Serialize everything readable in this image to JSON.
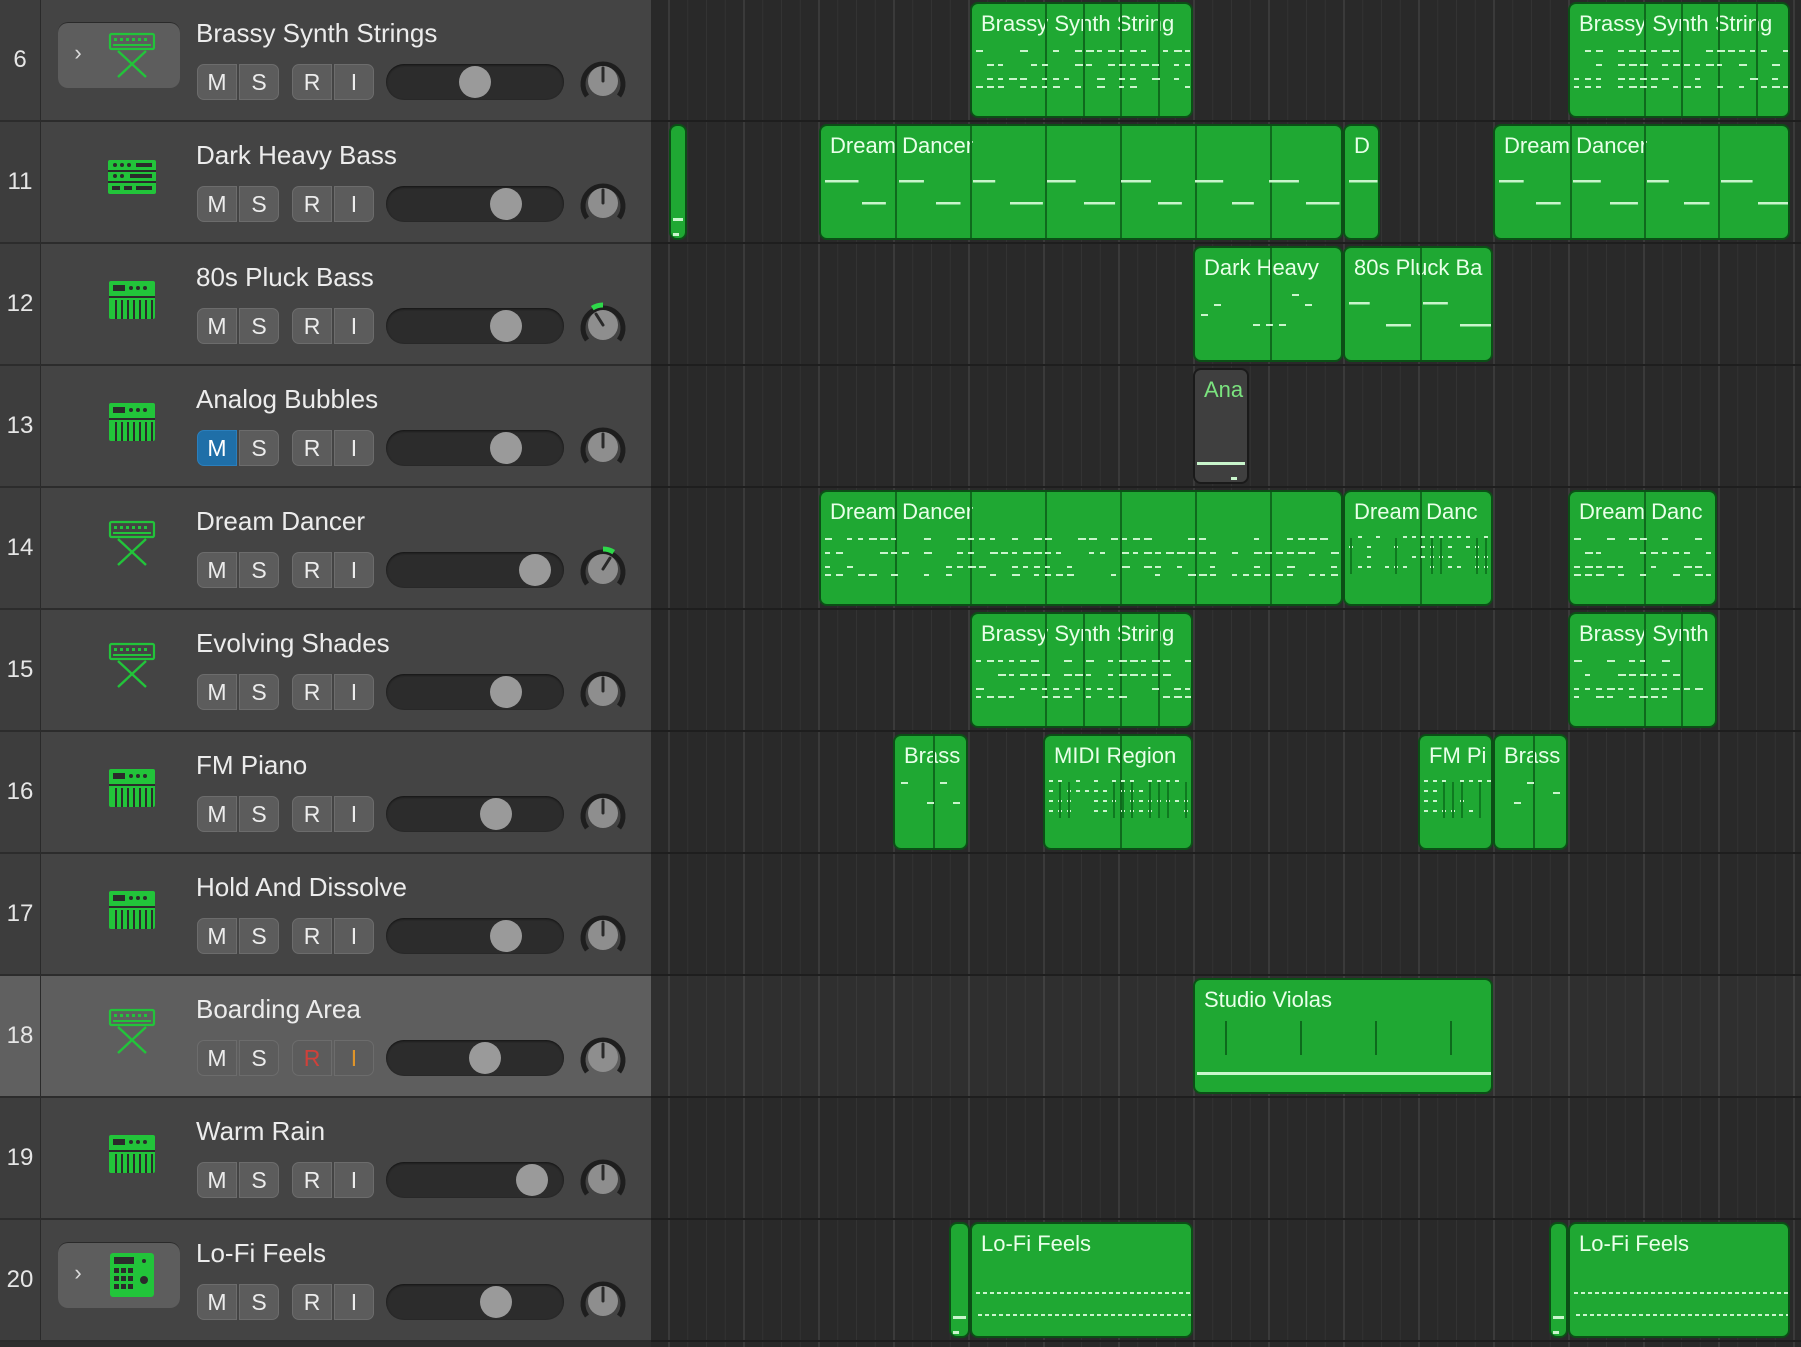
{
  "tracks": [
    {
      "number": "6",
      "name": "Brassy Synth Strings",
      "icon": "keyboard-stand-icon",
      "folder": true,
      "mute": false,
      "record": false,
      "input": false,
      "volume": 0.5,
      "pan": 0
    },
    {
      "number": "11",
      "name": "Dark Heavy Bass",
      "icon": "synth-rack-icon",
      "folder": false,
      "mute": false,
      "record": false,
      "input": false,
      "volume": 0.72,
      "pan": 0
    },
    {
      "number": "12",
      "name": "80s Pluck Bass",
      "icon": "synth-keyboard-icon",
      "folder": false,
      "mute": false,
      "record": false,
      "input": false,
      "volume": 0.72,
      "pan": -0.2
    },
    {
      "number": "13",
      "name": "Analog Bubbles",
      "icon": "synth-keyboard-icon",
      "folder": false,
      "mute": true,
      "record": false,
      "input": false,
      "volume": 0.72,
      "pan": 0
    },
    {
      "number": "14",
      "name": "Dream Dancer",
      "icon": "keyboard-stand-icon",
      "folder": false,
      "mute": false,
      "record": false,
      "input": false,
      "volume": 0.92,
      "pan": 0.2
    },
    {
      "number": "15",
      "name": "Evolving Shades",
      "icon": "keyboard-stand-icon",
      "folder": false,
      "mute": false,
      "record": false,
      "input": false,
      "volume": 0.72,
      "pan": 0
    },
    {
      "number": "16",
      "name": "FM Piano",
      "icon": "synth-keyboard-icon",
      "folder": false,
      "mute": false,
      "record": false,
      "input": false,
      "volume": 0.65,
      "pan": 0
    },
    {
      "number": "17",
      "name": "Hold And Dissolve",
      "icon": "synth-keyboard-icon",
      "folder": false,
      "mute": false,
      "record": false,
      "input": false,
      "volume": 0.72,
      "pan": 0
    },
    {
      "number": "18",
      "name": "Boarding Area",
      "icon": "keyboard-stand-icon",
      "folder": false,
      "selected": true,
      "mute": false,
      "record": true,
      "input": true,
      "volume": 0.57,
      "pan": 0
    },
    {
      "number": "19",
      "name": "Warm Rain",
      "icon": "synth-keyboard-icon",
      "folder": false,
      "mute": false,
      "record": false,
      "input": false,
      "volume": 0.9,
      "pan": 0
    },
    {
      "number": "20",
      "name": "Lo-Fi Feels",
      "icon": "drum-machine-icon",
      "folder": true,
      "mute": false,
      "record": false,
      "input": false,
      "volume": 0.65,
      "pan": 0
    }
  ],
  "buttons": {
    "mute": "M",
    "solo": "S",
    "record": "R",
    "input": "I"
  },
  "colors": {
    "region": "#1fa833",
    "region_border": "#0b4f16",
    "mute_on": "#1f6fa8",
    "record_on": "#d0413a",
    "input_on": "#e0952a",
    "pan_indicator": "#2ed84a",
    "instrument_icon": "#22c43a"
  },
  "regions": [
    {
      "lane": 0,
      "name": "Brassy Synth String",
      "start": 970,
      "end": 1193,
      "segments": [
        1043,
        1081,
        1118,
        1156
      ],
      "pattern": "dense"
    },
    {
      "lane": 0,
      "name": "Brassy Synth String",
      "start": 1568,
      "end": 1790,
      "segments": [
        1642,
        1679,
        1716,
        1754
      ],
      "pattern": "dense"
    },
    {
      "lane": 1,
      "name": "",
      "start": 669,
      "end": 687,
      "segments": [],
      "pattern": "single"
    },
    {
      "lane": 1,
      "name": "Dream Dancer",
      "start": 819,
      "end": 1343,
      "segments": [
        893,
        968,
        1043,
        1118,
        1193,
        1268
      ],
      "pattern": "bass"
    },
    {
      "lane": 1,
      "name": "D",
      "start": 1343,
      "end": 1380,
      "segments": [],
      "pattern": "bass"
    },
    {
      "lane": 1,
      "name": "Dream Dancer",
      "start": 1493,
      "end": 1790,
      "segments": [
        1568,
        1642,
        1716
      ],
      "pattern": "bass"
    },
    {
      "lane": 2,
      "name": "Dark Heavy",
      "start": 1193,
      "end": 1343,
      "segments": [
        1268
      ],
      "pattern": "sparse"
    },
    {
      "lane": 2,
      "name": "80s Pluck Ba",
      "start": 1343,
      "end": 1493,
      "segments": [
        1418
      ],
      "pattern": "bass"
    },
    {
      "lane": 3,
      "name": "Ana",
      "start": 1193,
      "end": 1249,
      "segments": [],
      "pattern": "single",
      "muted": true
    },
    {
      "lane": 4,
      "name": "Dream Dancer",
      "start": 819,
      "end": 1343,
      "segments": [
        893,
        968,
        1043,
        1118,
        1193,
        1268
      ],
      "pattern": "dense"
    },
    {
      "lane": 4,
      "name": "Dream Danc",
      "start": 1343,
      "end": 1493,
      "segments": [
        1418
      ],
      "pattern": "chords"
    },
    {
      "lane": 4,
      "name": "Dream Danc",
      "start": 1568,
      "end": 1717,
      "segments": [
        1642
      ],
      "pattern": "dense"
    },
    {
      "lane": 5,
      "name": "Brassy Synth String",
      "start": 970,
      "end": 1193,
      "segments": [
        1043,
        1081,
        1118,
        1156
      ],
      "pattern": "dense"
    },
    {
      "lane": 5,
      "name": "Brassy Synth",
      "start": 1568,
      "end": 1717,
      "segments": [
        1642,
        1679
      ],
      "pattern": "dense"
    },
    {
      "lane": 6,
      "name": "Brass",
      "start": 893,
      "end": 968,
      "segments": [
        931
      ],
      "pattern": "sparse"
    },
    {
      "lane": 6,
      "name": "MIDI Region",
      "start": 1043,
      "end": 1193,
      "segments": [
        1118
      ],
      "pattern": "chords"
    },
    {
      "lane": 6,
      "name": "FM Pi",
      "start": 1418,
      "end": 1493,
      "segments": [],
      "pattern": "chords"
    },
    {
      "lane": 6,
      "name": "Brass",
      "start": 1493,
      "end": 1568,
      "segments": [
        1531
      ],
      "pattern": "sparse"
    },
    {
      "lane": 8,
      "name": "Studio Violas",
      "start": 1193,
      "end": 1493,
      "segments": [],
      "pattern": "sustain"
    },
    {
      "lane": 10,
      "name": "",
      "start": 949,
      "end": 970,
      "segments": [],
      "pattern": "single"
    },
    {
      "lane": 10,
      "name": "Lo-Fi Feels",
      "start": 970,
      "end": 1193,
      "segments": [],
      "pattern": "drums"
    },
    {
      "lane": 10,
      "name": "",
      "start": 1549,
      "end": 1568,
      "segments": [],
      "pattern": "single"
    },
    {
      "lane": 10,
      "name": "Lo-Fi Feels",
      "start": 1568,
      "end": 1790,
      "segments": [],
      "pattern": "drums"
    }
  ]
}
